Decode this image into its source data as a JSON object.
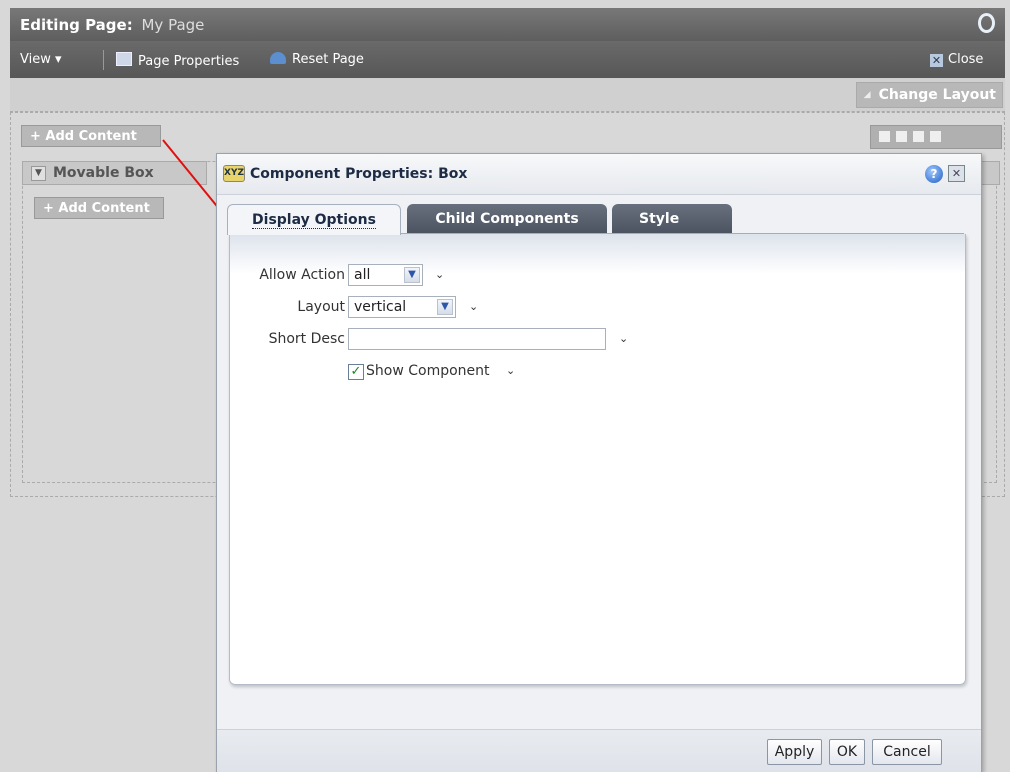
{
  "window": {
    "title_prefix": "Editing Page:",
    "page_name": "My Page"
  },
  "toolbar": {
    "view_label": "View ▾",
    "page_properties_label": "Page Properties",
    "reset_page_label": "Reset Page",
    "close_label": "Close"
  },
  "page": {
    "change_layout_label": "Change Layout",
    "add_content_label": "+ Add Content",
    "movable_box_label": "Movable Box",
    "box_add_content_label": "+ Add Content"
  },
  "dialog": {
    "title": "Component Properties: Box",
    "help_icon": "?",
    "close_icon": "✕",
    "icon_text": "XYZ",
    "tabs": [
      {
        "label": "Display Options",
        "selected": true
      },
      {
        "label": "Child Components",
        "selected": false
      },
      {
        "label": "Style",
        "selected": false
      }
    ],
    "fields": {
      "allow_action_label": "Allow Action",
      "allow_action_value": "all",
      "layout_label": "Layout",
      "layout_value": "vertical",
      "short_desc_label": "Short Desc",
      "short_desc_value": "",
      "show_component_label": "Show Component",
      "show_component_checked": true
    },
    "buttons": {
      "apply": "Apply",
      "ok": "OK",
      "cancel": "Cancel"
    }
  },
  "colors": {
    "titlebar": "#6a6a6a",
    "annotation_arrow": "#e01010",
    "tab_inactive": "#555e6a"
  }
}
